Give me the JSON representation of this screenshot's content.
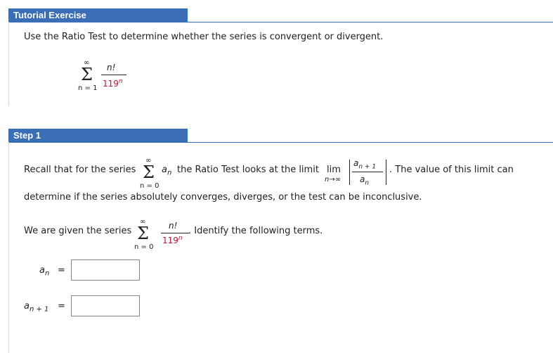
{
  "header": {
    "title": "Tutorial Exercise"
  },
  "problem": {
    "instruction": "Use the Ratio Test to determine whether the series is convergent or divergent.",
    "sum_upper": "∞",
    "sum_sigma": "Σ",
    "sum_lower": "n = 1",
    "numerator": "n!",
    "denominator_base": "119",
    "denominator_exp": "n"
  },
  "step1": {
    "title": "Step 1",
    "recall_prefix": "Recall that for the series",
    "series_upper": "∞",
    "series_sigma": "Σ",
    "series_lower": "n = 0",
    "series_term": "a",
    "series_term_sub": "n",
    "recall_mid": "the Ratio Test looks at the limit",
    "lim_text": "lim",
    "lim_sub": "n→∞",
    "ratio_num": "a",
    "ratio_num_sub": "n + 1",
    "ratio_den": "a",
    "ratio_den_sub": "n",
    "recall_suffix": ". The value of this limit can",
    "recall_line2": "determine if the series absolutely converges, diverges, or the test can be inconclusive.",
    "given_prefix": "We are given the series",
    "given_upper": "∞",
    "given_sigma": "Σ",
    "given_lower": "n = 0",
    "given_num": "n!",
    "given_den_base": "119",
    "given_den_exp": "n",
    "given_suffix": ". Identify the following terms.",
    "an_label": "a",
    "an_sub": "n",
    "an_eq": "=",
    "an_value": "",
    "an1_label": "a",
    "an1_sub": "n + 1",
    "an1_eq": "=",
    "an1_value": ""
  }
}
